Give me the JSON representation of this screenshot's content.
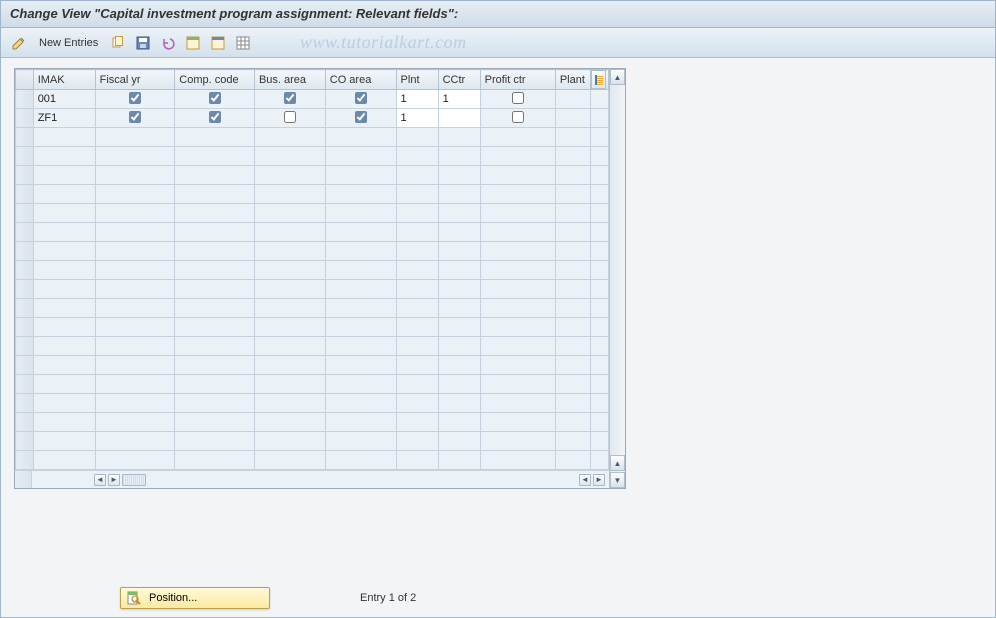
{
  "title": "Change View \"Capital investment program assignment: Relevant fields\":",
  "toolbar": {
    "new_entries_label": "New Entries"
  },
  "watermark": "www.tutorialkart.com",
  "columns": {
    "c0": "IMAK",
    "c1": "Fiscal yr",
    "c2": "Comp. code",
    "c3": "Bus. area",
    "c4": "CO area",
    "c5": "Plnt",
    "c6": "CCtr",
    "c7": "Profit ctr",
    "c8": "Plant"
  },
  "rows": [
    {
      "imak": "001",
      "fiscal_yr": true,
      "comp_code": true,
      "bus_area": true,
      "co_area": true,
      "plnt": "1",
      "cctr": "1",
      "profit_ctr": false
    },
    {
      "imak": "ZF1",
      "fiscal_yr": true,
      "comp_code": true,
      "bus_area": false,
      "co_area": true,
      "plnt": "1",
      "cctr": "",
      "profit_ctr": false
    }
  ],
  "empty_row_count": 18,
  "position_button": "Position...",
  "entry_status": "Entry 1 of 2"
}
